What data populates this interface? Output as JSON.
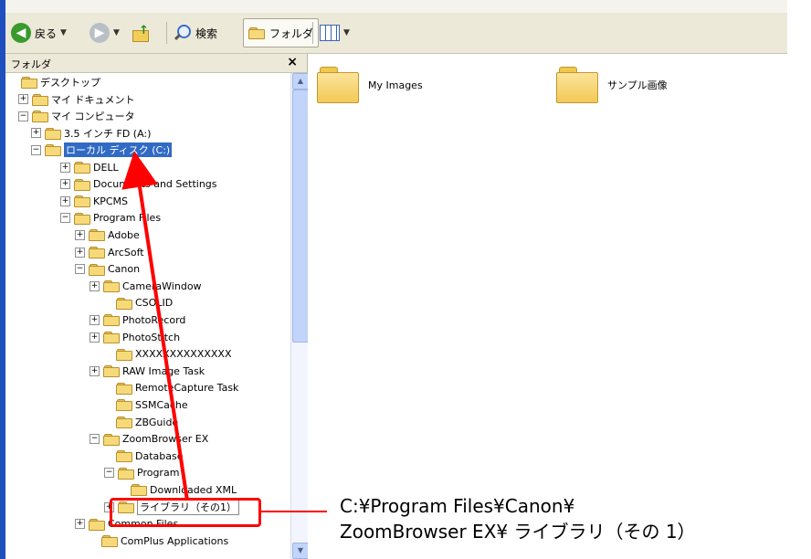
{
  "toolbar": {
    "back": "戻る",
    "search": "検索",
    "folders": "フォルダ"
  },
  "folder_pane": {
    "title": "フォルダ",
    "close": "×",
    "tree": [
      {
        "label": "デスクトップ",
        "expander": ""
      },
      {
        "label": "マイ ドキュメント",
        "expander": "+"
      },
      {
        "label": "マイ コンピュータ",
        "expander": "−"
      },
      {
        "label": "3.5 インチ FD (A:)",
        "expander": "+"
      },
      {
        "label": "ローカル ディスク (C:)",
        "expander": "−"
      },
      {
        "label": "DELL",
        "expander": "+"
      },
      {
        "label": "Documents and Settings",
        "expander": "+"
      },
      {
        "label": "KPCMS",
        "expander": "+"
      },
      {
        "label": "Program Files",
        "expander": "−"
      },
      {
        "label": "Adobe",
        "expander": "+"
      },
      {
        "label": "ArcSoft",
        "expander": "+"
      },
      {
        "label": "Canon",
        "expander": "−"
      },
      {
        "label": "CameraWindow",
        "expander": "+"
      },
      {
        "label": "CSOLID",
        "expander": ""
      },
      {
        "label": "PhotoRecord",
        "expander": "+"
      },
      {
        "label": "PhotoStitch",
        "expander": "+"
      },
      {
        "label": "XXXXXXXXXXXXXX",
        "expander": ""
      },
      {
        "label": "RAW Image Task",
        "expander": "+"
      },
      {
        "label": "RemoteCapture Task",
        "expander": ""
      },
      {
        "label": "SSMCache",
        "expander": ""
      },
      {
        "label": "ZBGuide",
        "expander": ""
      },
      {
        "label": "ZoomBrowser EX",
        "expander": "−"
      },
      {
        "label": "Database",
        "expander": ""
      },
      {
        "label": "Program",
        "expander": "−"
      },
      {
        "label": "Downloaded XML",
        "expander": ""
      },
      {
        "label": "ライブラリ（その1）",
        "expander": "+"
      },
      {
        "label": "Common Files",
        "expander": "+"
      },
      {
        "label": "ComPlus Applications",
        "expander": ""
      }
    ]
  },
  "content": {
    "items": [
      {
        "name": "My Images"
      },
      {
        "name": "サンプル画像"
      }
    ]
  },
  "caption": {
    "line1": "C:¥Program Files¥Canon¥",
    "line2": "ZoomBrowser EX¥ ライブラリ（その 1）"
  },
  "colors": {
    "annotation": "#ff0000",
    "selection": "#316ac5"
  }
}
